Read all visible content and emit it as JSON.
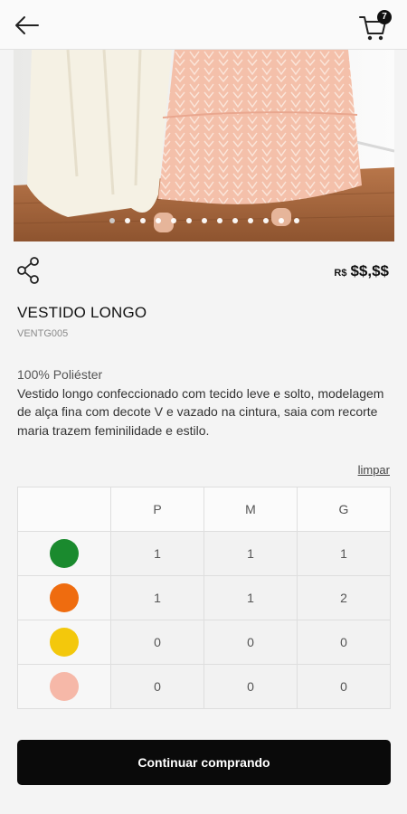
{
  "header": {
    "back_icon": "arrow-left-icon",
    "cart_icon": "cart-icon",
    "cart_count": "7"
  },
  "gallery": {
    "image_count": 13,
    "active_index": 0
  },
  "product": {
    "currency": "R$",
    "price": "$$,$$",
    "name": "VESTIDO LONGO",
    "sku": "VENTG005",
    "material": "100% Poliéster",
    "description": "Vestido longo confeccionado com tecido leve e solto, modelagem de alça fina com decote V e vazado na cintura, saia com recorte maria trazem feminilidade e estilo."
  },
  "grid": {
    "clear_label": "limpar",
    "sizes": [
      "P",
      "M",
      "G"
    ],
    "rows": [
      {
        "color": "#1a8a2e",
        "qty": [
          "1",
          "1",
          "1"
        ]
      },
      {
        "color": "#ef6c0f",
        "qty": [
          "1",
          "1",
          "2"
        ]
      },
      {
        "color": "#f3c80c",
        "qty": [
          "0",
          "0",
          "0"
        ]
      },
      {
        "color": "#f6b8a8",
        "qty": [
          "0",
          "0",
          "0"
        ]
      }
    ]
  },
  "actions": {
    "continue_label": "Continuar comprando"
  }
}
